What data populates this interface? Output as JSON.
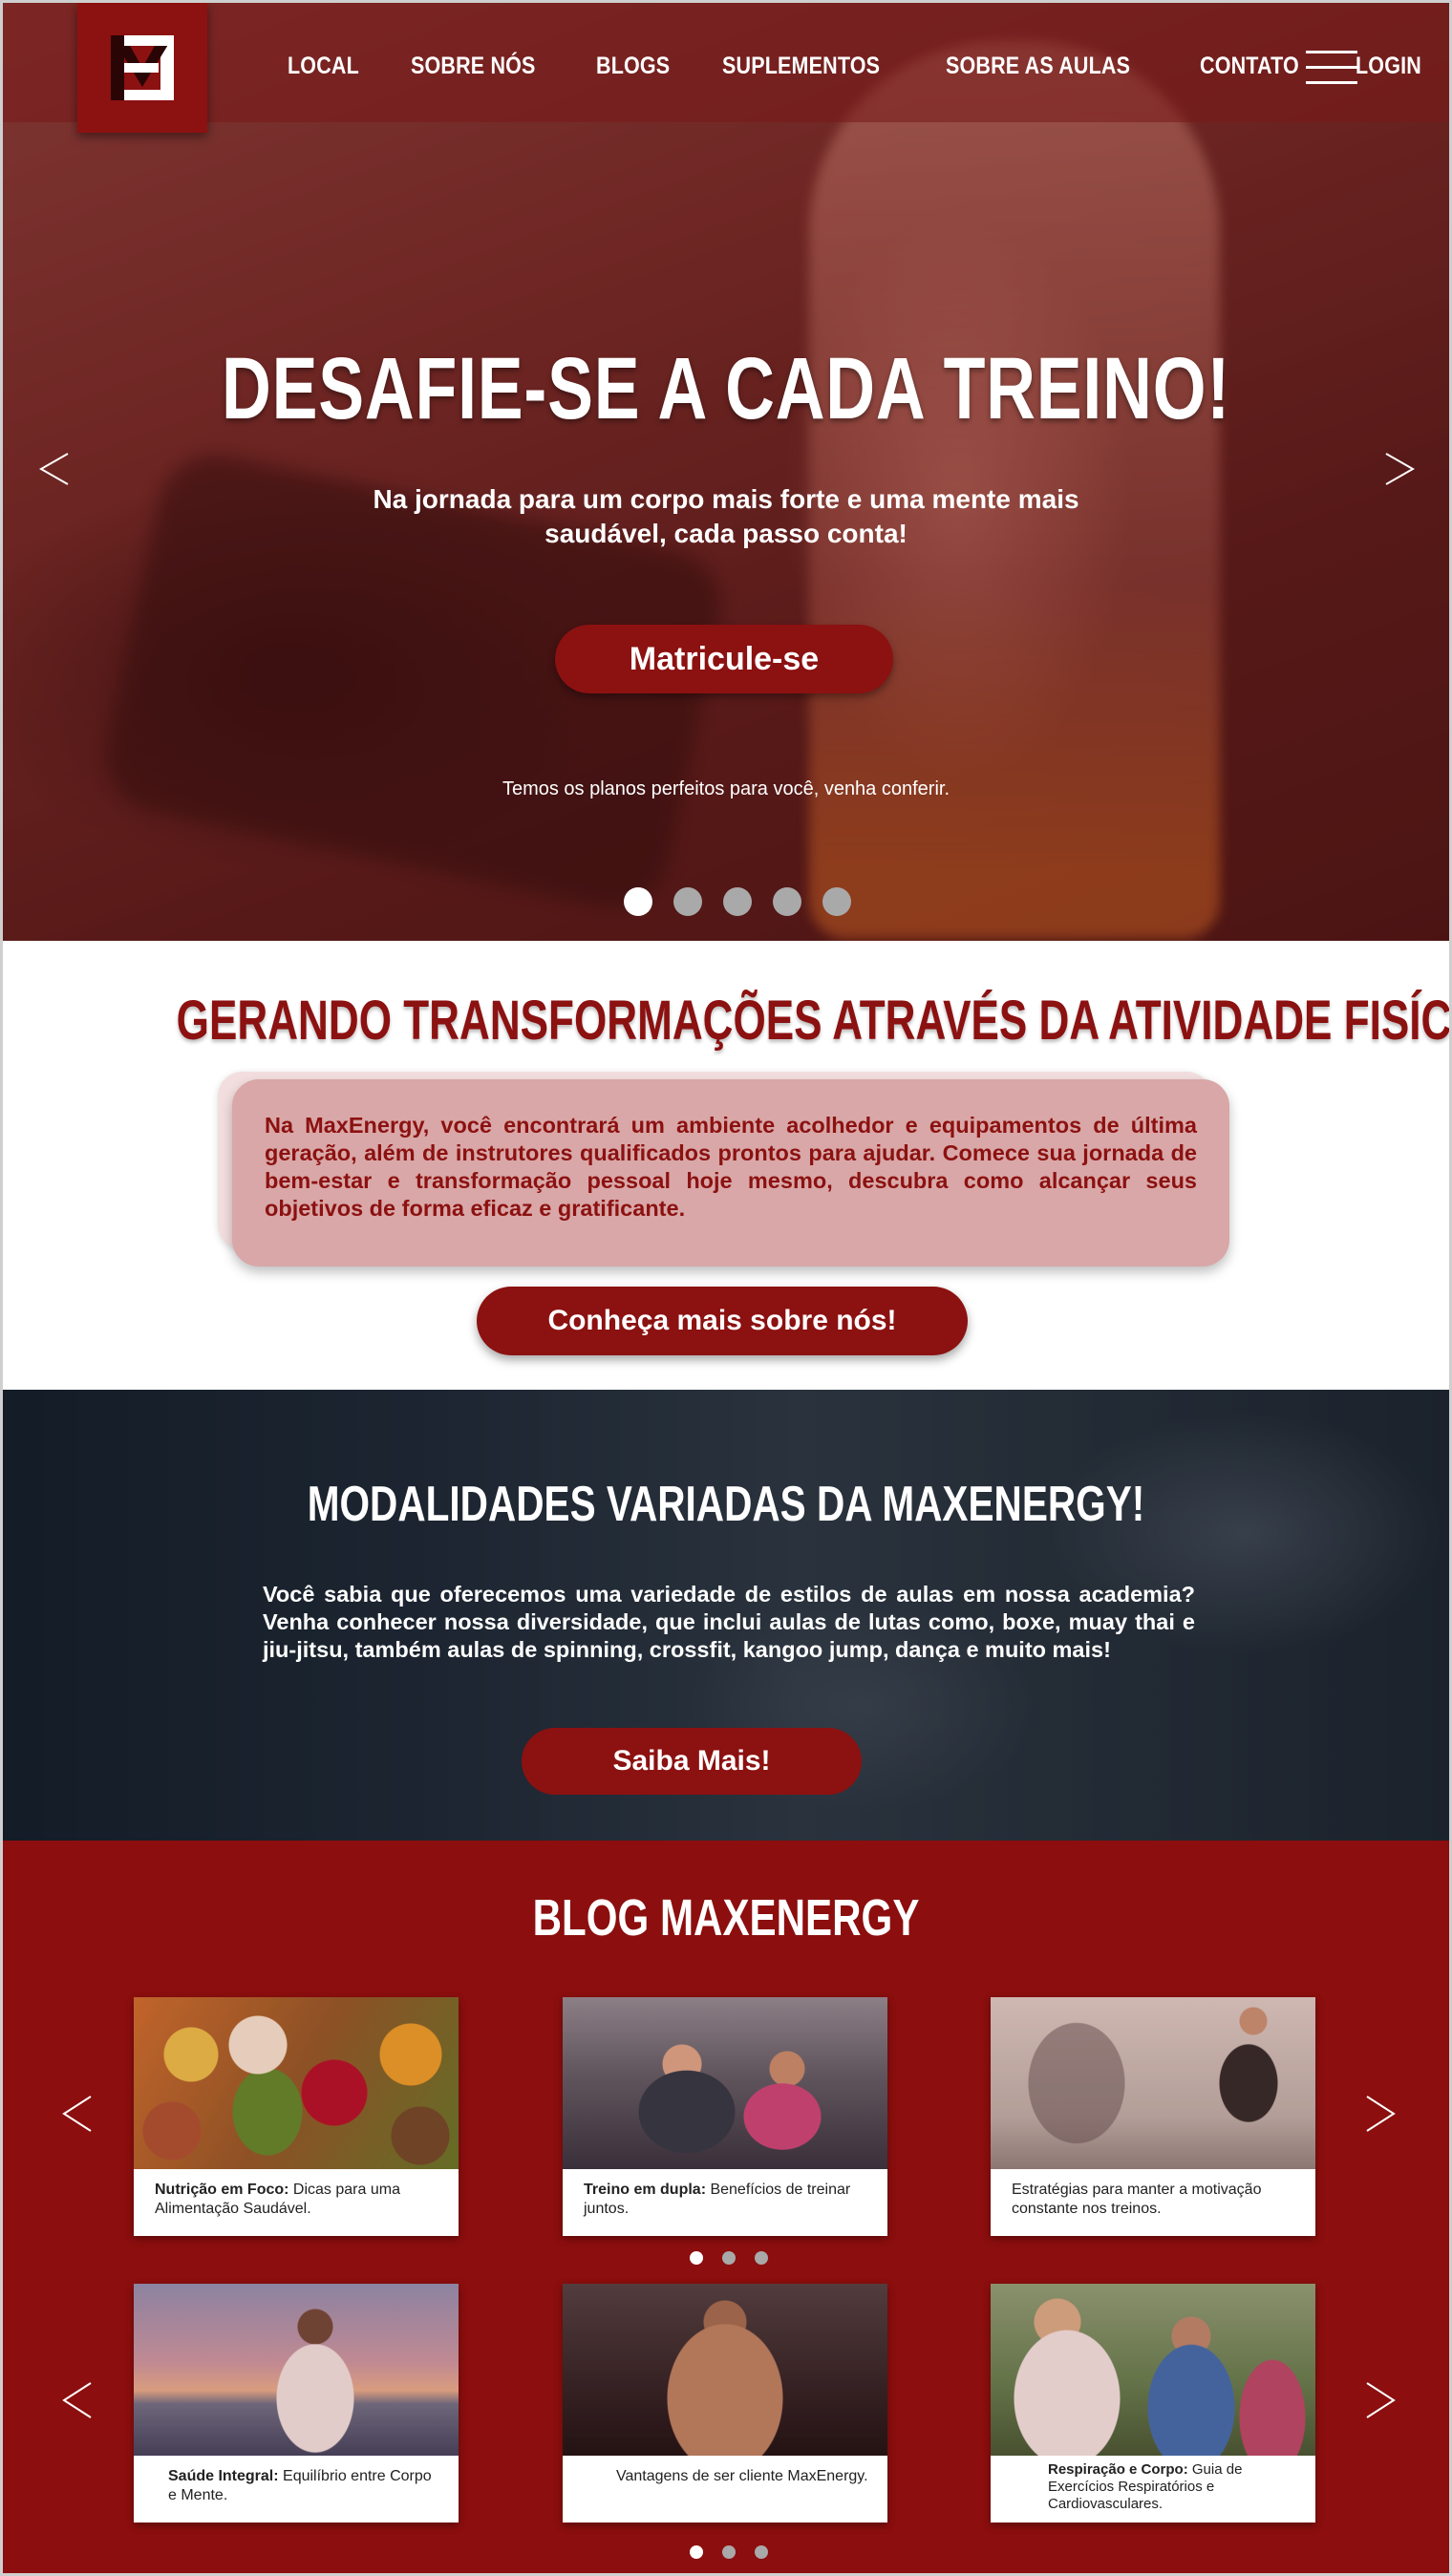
{
  "brand": {
    "logo_alt": "MaxEnergy",
    "accent": "#8c1111"
  },
  "nav": {
    "links": [
      "LOCAL",
      "SOBRE NÓS",
      "BLOGS",
      "SUPLEMENTOS",
      "SOBRE AS AULAS",
      "CONTATO",
      "LOGIN"
    ],
    "menu_icon": "hamburger-icon"
  },
  "hero": {
    "title": "DESAFIE-SE A CADA TREINO!",
    "subtitle": "Na jornada para um corpo mais forte e uma mente mais saudável, cada passo conta!",
    "cta": "Matricule-se",
    "note": "Temos os planos perfeitos para você, venha conferir.",
    "slides_total": 5,
    "active_slide": 1
  },
  "transform": {
    "title": "GERANDO TRANSFORMAÇÕES ATRAVÉS DA ATIVIDADE FISÍCA!",
    "text": "Na MaxEnergy, você encontrará um ambiente acolhedor e equipamentos de última geração, além de instrutores qualificados prontos para ajudar. Comece sua jornada de bem-estar e transformação pessoal hoje mesmo, descubra como alcançar seus objetivos de forma eficaz e gratificante.",
    "cta": "Conheça mais sobre nós!"
  },
  "modalidades": {
    "title": "MODALIDADES VARIADAS DA MAXENERGY!",
    "text": "Você sabia que oferecemos uma variedade de estilos de aulas em nossa academia? Venha conhecer nossa diversidade, que inclui aulas de lutas como, boxe, muay thai e  jiu-jitsu, também aulas de spinning, crossfit, kangoo jump, dança e muito mais!",
    "cta": "Saiba Mais!"
  },
  "blog": {
    "title": "BLOG MAXENERGY",
    "row1": [
      {
        "bold": "Nutrição em Foco:",
        "text": " Dicas para uma Alimentação Saudável."
      },
      {
        "bold": "Treino em dupla:",
        "text": " Benefícios de treinar juntos."
      },
      {
        "bold": "",
        "text": "Estratégias para manter a motivação constante nos treinos."
      }
    ],
    "row2": [
      {
        "bold": "Saúde Integral:",
        "text": " Equilíbrio entre Corpo e Mente."
      },
      {
        "bold": "",
        "text": "Vantagens de ser cliente MaxEnergy."
      },
      {
        "bold": "Respiração e Corpo:",
        "text": " Guia de Exercícios Respiratórios e Cardiovasculares."
      }
    ],
    "pages_total": 3,
    "active_page": 1
  }
}
